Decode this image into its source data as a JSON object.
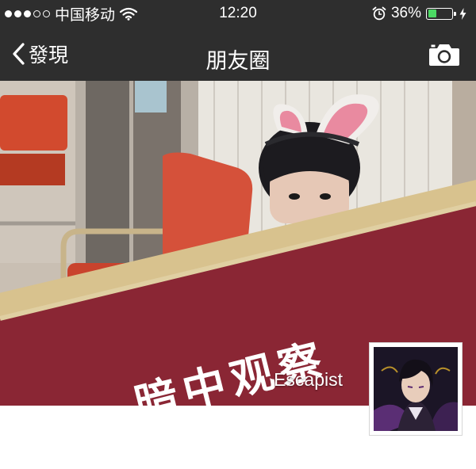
{
  "status_bar": {
    "carrier": "中国移动",
    "time": "12:20",
    "battery_percent": "36%",
    "battery_level": 0.36,
    "signal_bars_filled": 3,
    "signal_bars_total": 5,
    "icons": [
      "signal-dots-icon",
      "wifi-icon",
      "alarm-icon",
      "battery-icon",
      "charging-bolt-icon"
    ]
  },
  "nav": {
    "back_label": "發現",
    "title": "朋友圈",
    "right_icon": "camera-icon"
  },
  "cover": {
    "overlay_text": "暗中观察",
    "username": "Escapist"
  },
  "colors": {
    "bar_background": "#2e2e2e",
    "battery_green": "#4cd964",
    "page_background": "#ffffff"
  }
}
